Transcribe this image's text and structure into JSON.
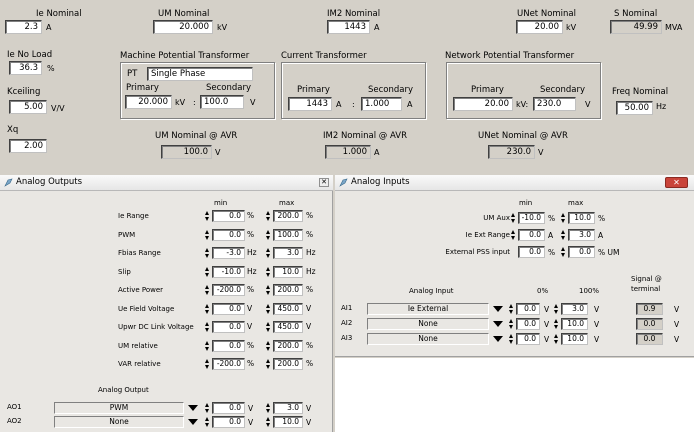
{
  "top": {
    "ie_nominal": {
      "label": "Ie Nominal",
      "value": "2.3",
      "unit": "A"
    },
    "um_nominal": {
      "label": "UM Nominal",
      "value": "20.000",
      "unit": "kV"
    },
    "im2_nominal": {
      "label": "IM2 Nominal",
      "value": "1443",
      "unit": "A"
    },
    "unet_nominal": {
      "label": "UNet Nominal",
      "value": "20.00",
      "unit": "kV"
    },
    "s_nominal": {
      "label": "S Nominal",
      "value": "49.99",
      "unit": "MVA"
    },
    "ie_no_load": {
      "label": "Ie No Load",
      "value": "36.3",
      "unit": "%"
    },
    "kceiling": {
      "label": "Kceiling",
      "value": "5.00",
      "unit": "V/V"
    },
    "xq": {
      "label": "Xq",
      "value": "2.00"
    },
    "mpt": {
      "title": "Machine Potential Transformer",
      "pt_label": "PT",
      "pt_value": "Single Phase",
      "primary_label": "Primary",
      "secondary_label": "Secondary",
      "primary": "20.000",
      "primary_unit": "kV",
      "sep": ":",
      "secondary": "100.0",
      "secondary_unit": "V"
    },
    "ct": {
      "title": "Current Transformer",
      "primary_label": "Primary",
      "secondary_label": "Secondary",
      "primary": "1443",
      "primary_unit": "A",
      "sep": ":",
      "secondary": "1.000",
      "secondary_unit": "A"
    },
    "npt": {
      "title": "Network Potential Transformer",
      "primary_label": "Primary",
      "secondary_label": "Secondary",
      "primary": "20.00",
      "primary_unit": "kV:",
      "secondary": "230.0",
      "secondary_unit": "V"
    },
    "freq": {
      "label": "Freq Nominal",
      "value": "50.00",
      "unit": "Hz"
    },
    "um_avr": {
      "label": "UM Nominal @ AVR",
      "value": "100.0",
      "unit": "V"
    },
    "im2_avr": {
      "label": "IM2 Nominal @ AVR",
      "value": "1.000",
      "unit": "A"
    },
    "unet_avr": {
      "label": "UNet Nominal @ AVR",
      "value": "230.0",
      "unit": "V"
    }
  },
  "analog_outputs": {
    "title": "Analog Outputs",
    "min_header": "min",
    "max_header": "max",
    "rows": [
      {
        "label": "Ie Range",
        "min": "0.0",
        "min_unit": "%",
        "max": "200.0",
        "max_unit": "%"
      },
      {
        "label": "PWM",
        "min": "0.0",
        "min_unit": "%",
        "max": "100.0",
        "max_unit": "%"
      },
      {
        "label": "Fbias Range",
        "min": "-3.0",
        "min_unit": "Hz",
        "max": "3.0",
        "max_unit": "Hz"
      },
      {
        "label": "Slip",
        "min": "-10.0",
        "min_unit": "Hz",
        "max": "10.0",
        "max_unit": "Hz"
      },
      {
        "label": "Active Power",
        "min": "-200.0",
        "min_unit": "%",
        "max": "200.0",
        "max_unit": "%"
      },
      {
        "label": "Ue Field Voltage",
        "min": "0.0",
        "min_unit": "V",
        "max": "450.0",
        "max_unit": "V"
      },
      {
        "label": "Upwr DC Link Voltage",
        "min": "0.0",
        "min_unit": "V",
        "max": "450.0",
        "max_unit": "V"
      },
      {
        "label": "UM relative",
        "min": "0.0",
        "min_unit": "%",
        "max": "200.0",
        "max_unit": "%"
      },
      {
        "label": "VAR relative",
        "min": "-200.0",
        "min_unit": "%",
        "max": "200.0",
        "max_unit": "%"
      }
    ],
    "output_header": "Analog Output",
    "outputs": [
      {
        "name": "AO1",
        "select": "PWM",
        "min": "0.0",
        "min_unit": "V",
        "max": "3.0",
        "max_unit": "V"
      },
      {
        "name": "AO2",
        "select": "None",
        "min": "0.0",
        "min_unit": "V",
        "max": "10.0",
        "max_unit": "V"
      }
    ]
  },
  "analog_inputs": {
    "title": "Analog Inputs",
    "min_header": "min",
    "max_header": "max",
    "rows": [
      {
        "label": "UM Aux",
        "min": "-10.0",
        "min_unit": "%",
        "max": "10.0",
        "max_unit": "%"
      },
      {
        "label": "Ie Ext Range",
        "min": "0.0",
        "min_unit": "A",
        "max": "3.0",
        "max_unit": "A"
      },
      {
        "label": "External PSS input",
        "min": "0.0",
        "min_unit": "%",
        "max": "0.0",
        "max_unit": "% UM"
      }
    ],
    "input_header": "Analog Input",
    "pct0_header": "0%",
    "pct100_header": "100%",
    "signal_header": "Signal @",
    "terminal_header": "terminal",
    "inputs": [
      {
        "name": "AI1",
        "select": "Ie External",
        "p0": "0.0",
        "p0_unit": "V",
        "p100": "3.0",
        "p100_unit": "V",
        "signal": "0.9",
        "signal_unit": "V"
      },
      {
        "name": "AI2",
        "select": "None",
        "p0": "0.0",
        "p0_unit": "V",
        "p100": "10.0",
        "p100_unit": "V",
        "signal": "0.0",
        "signal_unit": "V"
      },
      {
        "name": "AI3",
        "select": "None",
        "p0": "0.0",
        "p0_unit": "V",
        "p100": "10.0",
        "p100_unit": "V",
        "signal": "0.0",
        "signal_unit": "V"
      }
    ]
  },
  "colors": {
    "panel_bg": "#d4d0c8",
    "window_bg": "#e9e7e3",
    "close_btn": "#c9443a"
  }
}
